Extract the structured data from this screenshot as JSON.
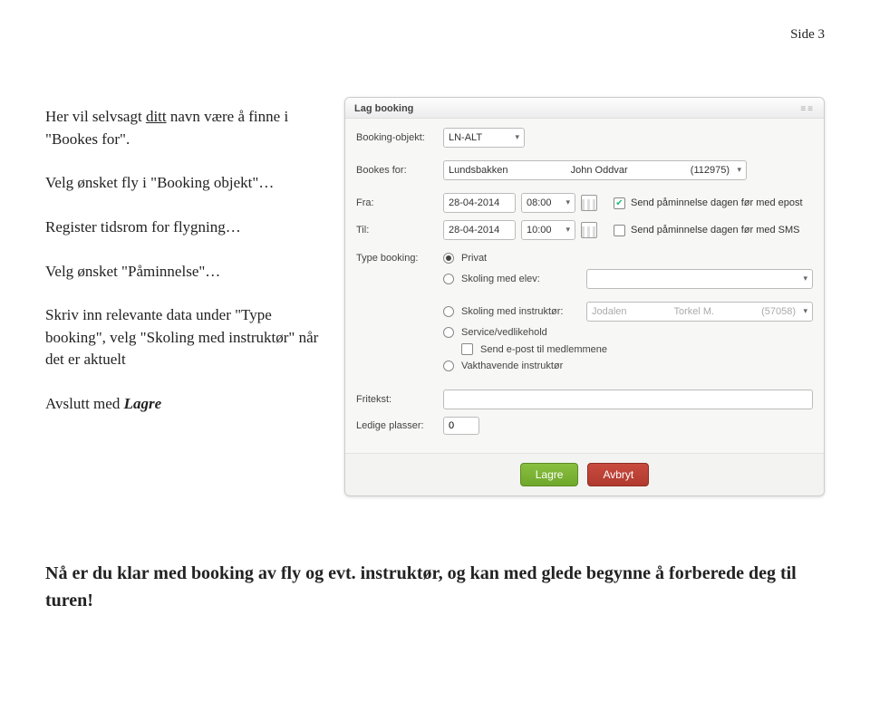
{
  "page_label": "Side 3",
  "left": {
    "p1_a": "Her vil selvsagt ",
    "p1_u": "ditt",
    "p1_b": " navn være å finne i \"Bookes for\".",
    "p2": "Velg ønsket fly i \"Booking objekt\"…",
    "p3": "Register tidsrom for flygning…",
    "p4": "Velg ønsket \"Påminnelse\"…",
    "p5": "Skriv inn relevante data under \"Type booking\", velg \"Skoling med instruktør\" når det er aktuelt",
    "p6_a": "Avslutt med ",
    "p6_b": "Lagre"
  },
  "dialog": {
    "title": "Lag booking",
    "labels": {
      "booking_objekt": "Booking-objekt:",
      "bookes_for": "Bookes for:",
      "fra": "Fra:",
      "til": "Til:",
      "type_booking": "Type booking:",
      "fritekst": "Fritekst:",
      "ledige_plasser": "Ledige plasser:"
    },
    "values": {
      "booking_objekt": "LN-ALT",
      "bookes_for_last": "Lundsbakken",
      "bookes_for_first": "John Oddvar",
      "bookes_for_id": "(112975)",
      "fra_date": "28-04-2014",
      "fra_time": "08:00",
      "til_date": "28-04-2014",
      "til_time": "10:00",
      "reminder_email": "Send påminnelse dagen før med epost",
      "reminder_sms": "Send påminnelse dagen før med SMS",
      "ledige_plasser": "0"
    },
    "types": {
      "privat": "Privat",
      "skoling_elev": "Skoling med elev:",
      "skoling_instr": "Skoling med instruktør:",
      "service": "Service/vedlikehold",
      "send_medlem": "Send e-post til medlemmene",
      "vakthavende": "Vakthavende instruktør",
      "instr_last": "Jodalen",
      "instr_first": "Torkel M.",
      "instr_id": "(57058)"
    },
    "buttons": {
      "lagre": "Lagre",
      "avbryt": "Avbryt"
    }
  },
  "bottom": {
    "text": "Nå er du klar med booking av fly og evt. instruktør, og kan med glede begynne å forberede deg til turen!"
  }
}
